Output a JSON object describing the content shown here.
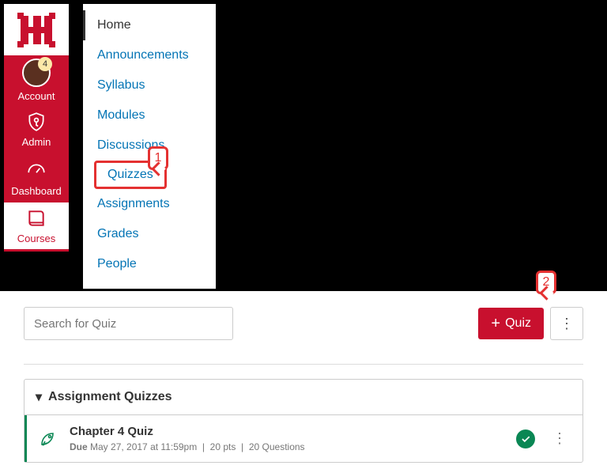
{
  "globalNav": {
    "account": {
      "label": "Account",
      "badge": "4"
    },
    "admin": {
      "label": "Admin"
    },
    "dashboard": {
      "label": "Dashboard"
    },
    "courses": {
      "label": "Courses"
    }
  },
  "courseNav": {
    "home": "Home",
    "announcements": "Announcements",
    "syllabus": "Syllabus",
    "modules": "Modules",
    "discussions": "Discussions",
    "quizzes": "Quizzes",
    "assignments": "Assignments",
    "grades": "Grades",
    "people": "People"
  },
  "callouts": {
    "one": "1",
    "two": "2"
  },
  "quizPage": {
    "searchPlaceholder": "Search for Quiz",
    "addButton": "Quiz",
    "groupTitle": "Assignment Quizzes",
    "item": {
      "title": "Chapter 4 Quiz",
      "dueLabel": "Due",
      "dueDate": "May 27, 2017 at 11:59pm",
      "points": "20 pts",
      "questions": "20 Questions"
    }
  }
}
